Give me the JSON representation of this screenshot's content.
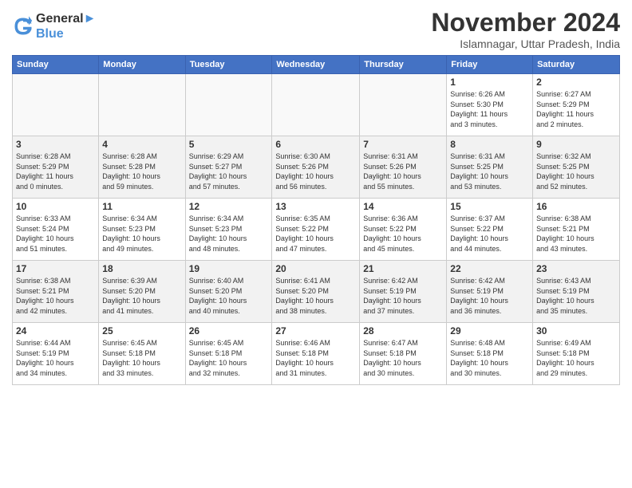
{
  "logo": {
    "line1": "General",
    "line2": "Blue"
  },
  "title": "November 2024",
  "subtitle": "Islamnagar, Uttar Pradesh, India",
  "headers": [
    "Sunday",
    "Monday",
    "Tuesday",
    "Wednesday",
    "Thursday",
    "Friday",
    "Saturday"
  ],
  "weeks": [
    [
      {
        "day": "",
        "info": "",
        "empty": true
      },
      {
        "day": "",
        "info": "",
        "empty": true
      },
      {
        "day": "",
        "info": "",
        "empty": true
      },
      {
        "day": "",
        "info": "",
        "empty": true
      },
      {
        "day": "",
        "info": "",
        "empty": true
      },
      {
        "day": "1",
        "info": "Sunrise: 6:26 AM\nSunset: 5:30 PM\nDaylight: 11 hours\nand 3 minutes."
      },
      {
        "day": "2",
        "info": "Sunrise: 6:27 AM\nSunset: 5:29 PM\nDaylight: 11 hours\nand 2 minutes."
      }
    ],
    [
      {
        "day": "3",
        "info": "Sunrise: 6:28 AM\nSunset: 5:29 PM\nDaylight: 11 hours\nand 0 minutes."
      },
      {
        "day": "4",
        "info": "Sunrise: 6:28 AM\nSunset: 5:28 PM\nDaylight: 10 hours\nand 59 minutes."
      },
      {
        "day": "5",
        "info": "Sunrise: 6:29 AM\nSunset: 5:27 PM\nDaylight: 10 hours\nand 57 minutes."
      },
      {
        "day": "6",
        "info": "Sunrise: 6:30 AM\nSunset: 5:26 PM\nDaylight: 10 hours\nand 56 minutes."
      },
      {
        "day": "7",
        "info": "Sunrise: 6:31 AM\nSunset: 5:26 PM\nDaylight: 10 hours\nand 55 minutes."
      },
      {
        "day": "8",
        "info": "Sunrise: 6:31 AM\nSunset: 5:25 PM\nDaylight: 10 hours\nand 53 minutes."
      },
      {
        "day": "9",
        "info": "Sunrise: 6:32 AM\nSunset: 5:25 PM\nDaylight: 10 hours\nand 52 minutes."
      }
    ],
    [
      {
        "day": "10",
        "info": "Sunrise: 6:33 AM\nSunset: 5:24 PM\nDaylight: 10 hours\nand 51 minutes."
      },
      {
        "day": "11",
        "info": "Sunrise: 6:34 AM\nSunset: 5:23 PM\nDaylight: 10 hours\nand 49 minutes."
      },
      {
        "day": "12",
        "info": "Sunrise: 6:34 AM\nSunset: 5:23 PM\nDaylight: 10 hours\nand 48 minutes."
      },
      {
        "day": "13",
        "info": "Sunrise: 6:35 AM\nSunset: 5:22 PM\nDaylight: 10 hours\nand 47 minutes."
      },
      {
        "day": "14",
        "info": "Sunrise: 6:36 AM\nSunset: 5:22 PM\nDaylight: 10 hours\nand 45 minutes."
      },
      {
        "day": "15",
        "info": "Sunrise: 6:37 AM\nSunset: 5:22 PM\nDaylight: 10 hours\nand 44 minutes."
      },
      {
        "day": "16",
        "info": "Sunrise: 6:38 AM\nSunset: 5:21 PM\nDaylight: 10 hours\nand 43 minutes."
      }
    ],
    [
      {
        "day": "17",
        "info": "Sunrise: 6:38 AM\nSunset: 5:21 PM\nDaylight: 10 hours\nand 42 minutes."
      },
      {
        "day": "18",
        "info": "Sunrise: 6:39 AM\nSunset: 5:20 PM\nDaylight: 10 hours\nand 41 minutes."
      },
      {
        "day": "19",
        "info": "Sunrise: 6:40 AM\nSunset: 5:20 PM\nDaylight: 10 hours\nand 40 minutes."
      },
      {
        "day": "20",
        "info": "Sunrise: 6:41 AM\nSunset: 5:20 PM\nDaylight: 10 hours\nand 38 minutes."
      },
      {
        "day": "21",
        "info": "Sunrise: 6:42 AM\nSunset: 5:19 PM\nDaylight: 10 hours\nand 37 minutes."
      },
      {
        "day": "22",
        "info": "Sunrise: 6:42 AM\nSunset: 5:19 PM\nDaylight: 10 hours\nand 36 minutes."
      },
      {
        "day": "23",
        "info": "Sunrise: 6:43 AM\nSunset: 5:19 PM\nDaylight: 10 hours\nand 35 minutes."
      }
    ],
    [
      {
        "day": "24",
        "info": "Sunrise: 6:44 AM\nSunset: 5:19 PM\nDaylight: 10 hours\nand 34 minutes."
      },
      {
        "day": "25",
        "info": "Sunrise: 6:45 AM\nSunset: 5:18 PM\nDaylight: 10 hours\nand 33 minutes."
      },
      {
        "day": "26",
        "info": "Sunrise: 6:45 AM\nSunset: 5:18 PM\nDaylight: 10 hours\nand 32 minutes."
      },
      {
        "day": "27",
        "info": "Sunrise: 6:46 AM\nSunset: 5:18 PM\nDaylight: 10 hours\nand 31 minutes."
      },
      {
        "day": "28",
        "info": "Sunrise: 6:47 AM\nSunset: 5:18 PM\nDaylight: 10 hours\nand 30 minutes."
      },
      {
        "day": "29",
        "info": "Sunrise: 6:48 AM\nSunset: 5:18 PM\nDaylight: 10 hours\nand 30 minutes."
      },
      {
        "day": "30",
        "info": "Sunrise: 6:49 AM\nSunset: 5:18 PM\nDaylight: 10 hours\nand 29 minutes."
      }
    ]
  ]
}
